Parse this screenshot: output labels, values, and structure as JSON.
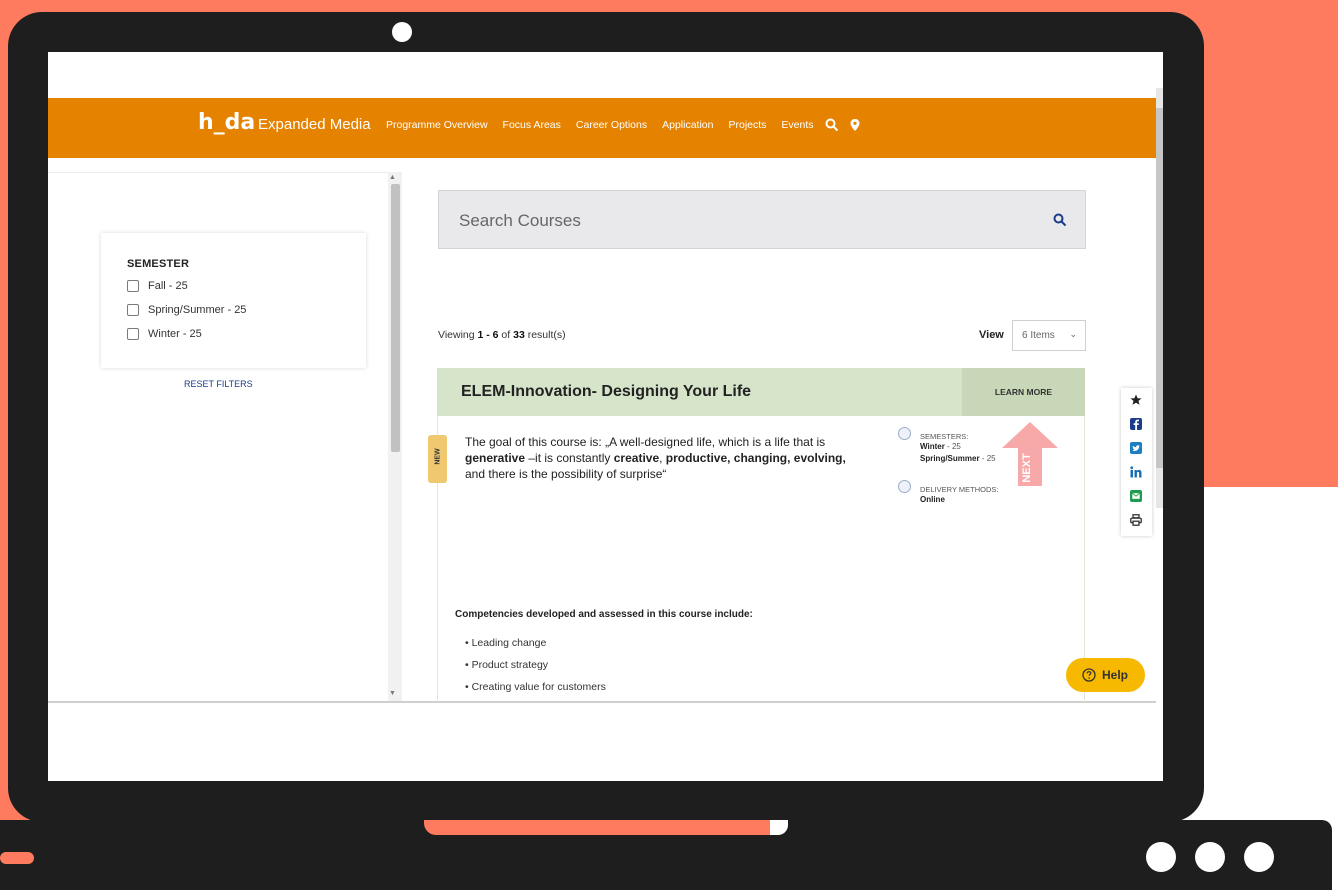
{
  "colors": {
    "coral_background": "#ff7b5f",
    "laptop_frame": "#1e1e1e",
    "navbar": "#e58200",
    "course_header": "#d6e4ca",
    "help_button": "#f7b800"
  },
  "navbar": {
    "brand": "h_da",
    "brand_sub": "Expanded Media",
    "links": [
      "Programme Overview",
      "Focus Areas",
      "Career Options",
      "Application",
      "Projects",
      "Events"
    ],
    "icons": [
      "search-icon",
      "location-pin-icon"
    ]
  },
  "filters": {
    "heading": "SEMESTER",
    "options": [
      "Fall - 25",
      "Spring/Summer - 25",
      "Winter - 25"
    ],
    "reset_label": "RESET FILTERS"
  },
  "search": {
    "placeholder": "Search Courses"
  },
  "results": {
    "viewing_prefix": "Viewing ",
    "range": "1 - 6",
    "of": " of ",
    "total": "33",
    "suffix": " result(s)",
    "view_label": "View",
    "view_selected": "6 Items"
  },
  "course": {
    "title": "ELEM-Innovation- Designing Your Life",
    "learn_more": "LEARN MORE",
    "badge": "NEW",
    "desc_part1": "The goal of this course is: „A well-designed life, which is a life that is ",
    "desc_bold1": "generative",
    "desc_part2": " –it is constantly ",
    "desc_bold2": "creative",
    "desc_part3": ", ",
    "desc_bold3": "productive, changing, evolving,",
    "desc_part4": " and there is the possibility of surprise“",
    "semesters_label": "SEMESTERS:",
    "semester_1_name": "Winter",
    "semester_1_val": " - 25",
    "semester_2_name": "Spring/Summer",
    "semester_2_val": " - 25",
    "delivery_label": "DELIVERY METHODS:",
    "delivery_value": "Online",
    "next_label": "NEXT",
    "competencies_heading": "Competencies developed and assessed in this course include:",
    "competencies": [
      "Leading change",
      "Product strategy",
      "Creating value for customers"
    ]
  },
  "share_bar": [
    "star-icon",
    "facebook-icon",
    "twitter-icon",
    "linkedin-icon",
    "email-icon",
    "print-icon"
  ],
  "help": {
    "label": "Help"
  }
}
